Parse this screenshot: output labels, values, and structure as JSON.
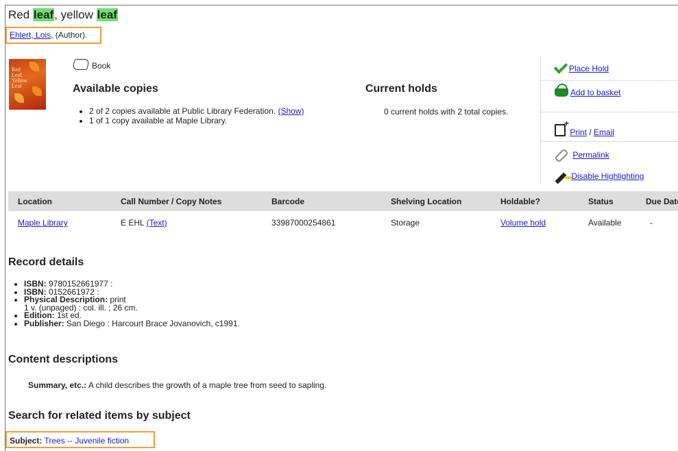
{
  "record": {
    "title_pre": "Red ",
    "title_hl1": "leaf",
    "title_mid": ", yellow ",
    "title_hl2": "leaf",
    "author_name": "Ehlert, Lois,",
    "author_role": " (Author).",
    "cover_text": "Red Leaf, Yellow Leaf",
    "format": "Book"
  },
  "availability": {
    "heading": "Available copies",
    "items": [
      {
        "text": "2 of 2 copies available at Public Library Federation. ",
        "link": "(Show)"
      },
      {
        "text": "1 of 1 copy available at Maple Library.",
        "link": ""
      }
    ]
  },
  "holds": {
    "heading": "Current holds",
    "text": "0 current holds with 2 total copies."
  },
  "actions": {
    "place_hold": "Place Hold",
    "add_basket": "Add to basket",
    "print": "Print",
    "slash": " / ",
    "email": "Email",
    "permalink": "Permalink",
    "disable_highlight": "Disable Highlighting"
  },
  "copies_table": {
    "headers": [
      "Location",
      "Call Number / Copy Notes",
      "Barcode",
      "Shelving Location",
      "Holdable?",
      "Status",
      "Due Date"
    ],
    "rows": [
      {
        "location": "Maple Library",
        "call_number": "E EHL ",
        "call_link": "(Text)",
        "barcode": "33987000254861",
        "shelving": "Storage",
        "holdable": "Volume hold",
        "status": "Available",
        "due_date": "-"
      }
    ]
  },
  "details": {
    "heading": "Record details",
    "items": [
      {
        "label": "ISBN:",
        "value": " 9780152661977 :"
      },
      {
        "label": "ISBN:",
        "value": " 0152661972 :"
      },
      {
        "label": "Physical Description:",
        "value": " print",
        "extra": "1 v. (unpaged) : col. ill. ; 26 cm."
      },
      {
        "label": "Edition:",
        "value": " 1st ed."
      },
      {
        "label": "Publisher:",
        "value": " San Diego : Harcourt Brace Jovanovich, c1991."
      }
    ]
  },
  "content": {
    "heading": "Content descriptions",
    "summary_label": "Summary, etc.:",
    "summary_text": " A child describes the growth of a maple tree from seed to sapling."
  },
  "related": {
    "heading": "Search for related items by subject",
    "subject_label": "Subject:",
    "subject_value": " Trees -- Juvenile fiction"
  }
}
